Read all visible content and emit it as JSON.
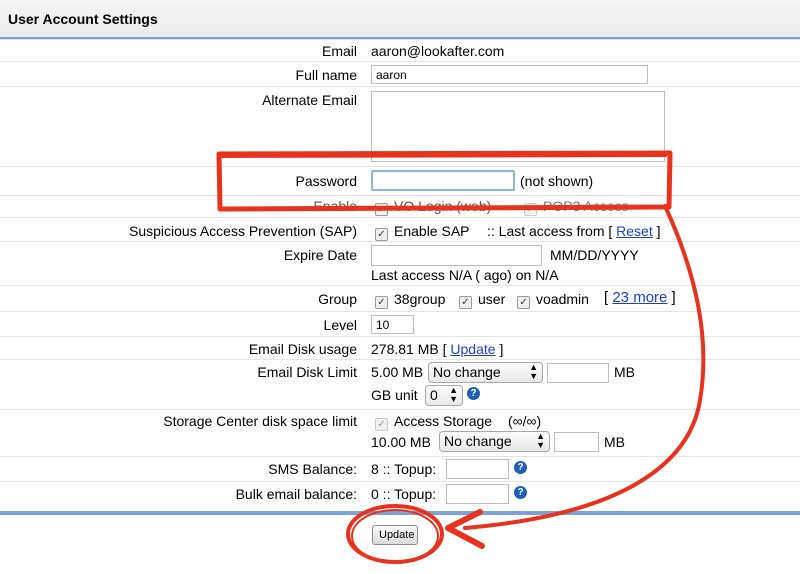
{
  "header": {
    "title": "User Account Settings"
  },
  "fields": {
    "email": {
      "label": "Email",
      "value": "aaron@lookafter.com"
    },
    "full_name": {
      "label": "Full name",
      "value": "aaron"
    },
    "alternate_email": {
      "label": "Alternate Email",
      "value": ""
    },
    "password": {
      "label": "Password",
      "value": "",
      "note": "(not shown)"
    },
    "enable": {
      "label": "Enable",
      "opt1": "VO Login (web)",
      "opt2": "POP3 Access"
    },
    "sap": {
      "label": "Suspicious Access Prevention (SAP)",
      "checkbox_label": "Enable SAP",
      "last_access_text": ":: Last access from [",
      "reset_link": "Reset",
      "close_bracket": "]"
    },
    "expire_date": {
      "label": "Expire Date",
      "value": "",
      "format_hint": "MM/DD/YYYY",
      "last_access_note": "Last access N/A ( ago) on N/A"
    },
    "group": {
      "label": "Group",
      "options": [
        "38group",
        "user",
        "voadmin"
      ],
      "more_open": "[",
      "more_link": "23 more",
      "more_close": "]"
    },
    "level": {
      "label": "Level",
      "value": "10"
    },
    "email_disk_usage": {
      "label": "Email Disk usage",
      "value": "278.81 MB",
      "open": "[",
      "update_link": "Update",
      "close": "]"
    },
    "email_disk_limit": {
      "label": "Email Disk Limit",
      "current": "5.00 MB",
      "select_value": "No change",
      "unit": "MB",
      "gb_unit_label": "GB unit",
      "gb_unit_value": "0"
    },
    "storage_center": {
      "label": "Storage Center disk space limit",
      "checkbox_label": "Access Storage",
      "usage": "(∞/∞)",
      "current": "10.00 MB",
      "select_value": "No change",
      "unit": "MB"
    },
    "sms_balance": {
      "label": "SMS Balance:",
      "value": "8 :: Topup:"
    },
    "bulk_email_balance": {
      "label": "Bulk email balance:",
      "value": "0 :: Topup:"
    }
  },
  "actions": {
    "update_button": "Update"
  },
  "colors": {
    "annotation": "#e8321e",
    "header_rule": "#7aa1d8",
    "link": "#1a3fcc"
  },
  "icons": {
    "help": "question-help-icon",
    "select_arrow": "updown-arrow-icon",
    "checkbox": "checkmark-icon"
  }
}
